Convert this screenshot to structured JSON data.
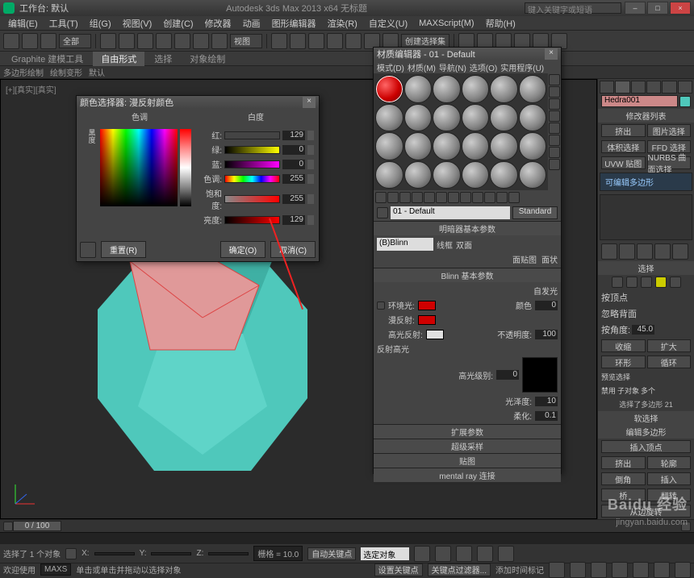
{
  "title": {
    "workspace": "工作台: 默认",
    "app": "Autodesk 3ds Max  2013 x64   无标题",
    "search_placeholder": "键入关键字或短语"
  },
  "win_buttons": [
    "–",
    "□",
    "×"
  ],
  "menubar": [
    "编辑(E)",
    "工具(T)",
    "组(G)",
    "视图(V)",
    "创建(C)",
    "修改器",
    "动画",
    "图形编辑器",
    "渲染(R)",
    "自定义(U)",
    "MAXScript(M)",
    "帮助(H)"
  ],
  "toolbar": {
    "combo1": "全部",
    "combo2": "视图",
    "combo3": "创建选择集"
  },
  "ribbon_tabs": [
    "Graphite 建模工具",
    "自由形式",
    "选择",
    "对象绘制"
  ],
  "ribbon_active": 1,
  "subribbon": [
    "多边形绘制",
    "绘制变形",
    "默认"
  ],
  "viewport_label": "[+][真实][真实]",
  "color_dialog": {
    "title": "颜色选择器: 漫反射颜色",
    "hue_label": "色调",
    "white_label": "白度",
    "black_label": "黑度",
    "channels": [
      {
        "label": "红:",
        "color": "linear-gradient(to right,#000,#f00)",
        "val": "129"
      },
      {
        "label": "绿:",
        "color": "linear-gradient(to right,#000,#ff0)",
        "val": "0"
      },
      {
        "label": "蓝:",
        "color": "linear-gradient(to right,#000,#f0f)",
        "val": "0"
      },
      {
        "label": "色调:",
        "color": "linear-gradient(to right,#f00,#ff0,#0f0,#0ff,#00f,#f0f,#f00)",
        "val": "255"
      },
      {
        "label": "饱和度:",
        "color": "linear-gradient(to right,#888,#f00)",
        "val": "255"
      },
      {
        "label": "亮度:",
        "color": "linear-gradient(to right,#000,#f00)",
        "val": "129"
      }
    ],
    "old_color": "#c8c8c8",
    "new_color": "#d00000",
    "reset": "重置(R)",
    "ok": "确定(O)",
    "cancel": "取消(C)"
  },
  "material_editor": {
    "title": "材质编辑器 - 01 - Default",
    "menu": [
      "模式(D)",
      "材质(M)",
      "导航(N)",
      "选项(O)",
      "实用程序(U)"
    ],
    "name": "01 - Default",
    "type": "Standard",
    "rollout_basic_title": "明暗器基本参数",
    "shader": "(B)Blinn",
    "cb_wire": "线框",
    "cb_2side": "双面",
    "cb_facemap": "面贴图",
    "cb_faceted": "面状",
    "rollout_blinn_title": "Blinn 基本参数",
    "selfillum_label": "自发光",
    "color_cb": "颜色",
    "selfillum_val": "0",
    "ambient": "环境光:",
    "ambient_color": "#d00000",
    "diffuse": "漫反射:",
    "diffuse_color": "#d00000",
    "spec": "高光反射:",
    "spec_color": "#e0e0e0",
    "opacity": "不透明度:",
    "opacity_val": "100",
    "spechi": "反射高光",
    "speclevel": "高光级别:",
    "speclevel_val": "0",
    "gloss": "光泽度:",
    "gloss_val": "10",
    "soften": "柔化:",
    "soften_val": "0.1",
    "collapsed": [
      "扩展参数",
      "超级采样",
      "贴图",
      "mental ray 连接"
    ]
  },
  "side": {
    "object_name": "Hedra001",
    "modlist_title": "修改器列表",
    "mod_item": "可编辑多边形",
    "btns": [
      [
        "挤出",
        "图片选择"
      ],
      [
        "体积选择",
        "FFD 选择"
      ],
      [
        "UVW 贴图",
        "NURBS 曲面选择"
      ]
    ],
    "sel_title": "选择",
    "cb_vertex": "按顶点",
    "cb_ignore": "忽略背面",
    "cb_angle": "按角度:",
    "angle_val": "45.0",
    "shrink": "收缩",
    "grow": "扩大",
    "ring": "环形",
    "loop": "循环",
    "preview": "预览选择",
    "off": "禁用",
    "subobj": "子对象",
    "multi": "多个",
    "sel_info": "选择了多边形 21",
    "soft_title": "软选择",
    "editpoly_title": "编辑多边形",
    "insvertex": "插入顶点",
    "extrude": "挤出",
    "outline": "轮廓",
    "bevel": "倒角",
    "inset": "插入",
    "bridge": "桥",
    "flip": "翻转",
    "fromedge": "从边旋转"
  },
  "timeline": {
    "pos": "0 / 100"
  },
  "status": {
    "sel": "选择了 1 个对象",
    "x": "X:",
    "y": "Y:",
    "z": "Z:",
    "grid": "栅格 = 10.0",
    "autokey": "自动关键点",
    "selset": "选定对象",
    "setkey": "设置关键点",
    "keyfilter": "关键点过滤器..."
  },
  "prompt": {
    "welcome": "欢迎使用",
    "maxs": "MAXS",
    "hint": "单击或单击并拖动以选择对象",
    "addtime": "添加时间标记"
  },
  "watermark": {
    "brand": "Baidu 经验",
    "url": "jingyan.baidu.com"
  }
}
